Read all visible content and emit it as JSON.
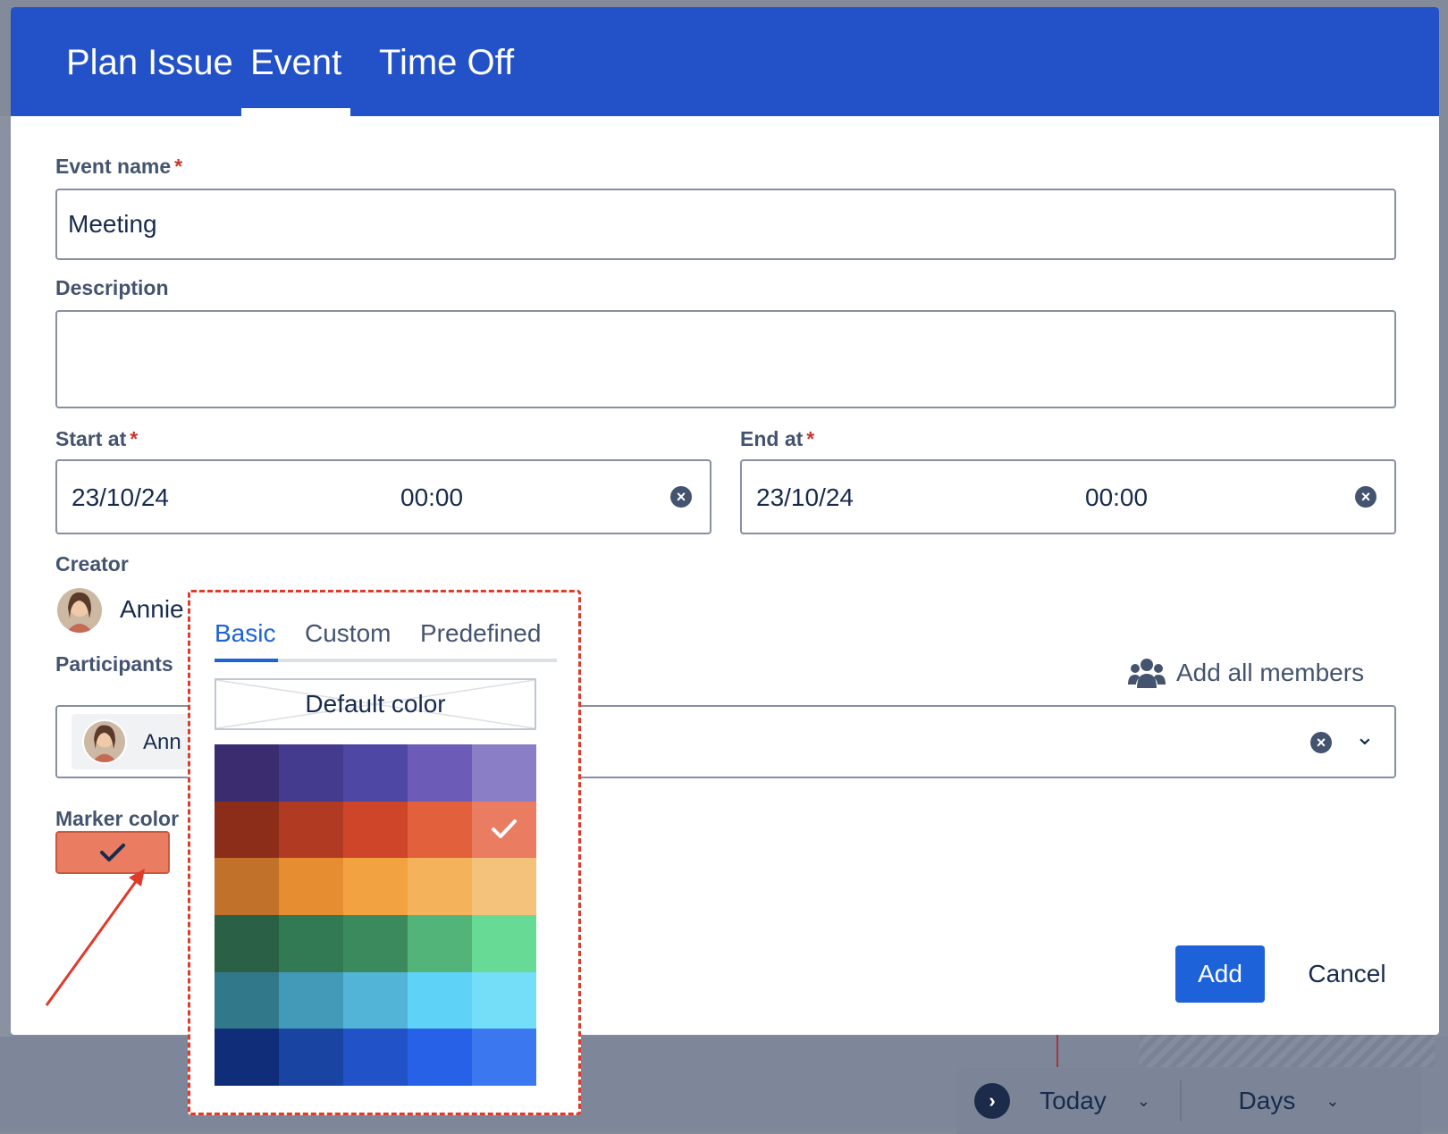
{
  "tabs": [
    {
      "label": "Plan Issue",
      "active": false
    },
    {
      "label": "Event",
      "active": true
    },
    {
      "label": "Time Off",
      "active": false
    }
  ],
  "form": {
    "event_name_label": "Event name",
    "required_mark": "*",
    "event_name_value": "Meeting",
    "description_label": "Description",
    "description_value": "",
    "start_label": "Start at",
    "start_date": "23/10/24",
    "start_time": "00:00",
    "end_label": "End at",
    "end_date": "23/10/24",
    "end_time": "00:00",
    "creator_label": "Creator",
    "creator_name": "Annie",
    "participants_label": "Participants",
    "add_all_label": "Add all members",
    "participant_chip": "Ann",
    "marker_color_label": "Marker color",
    "marker_color_value": "#e97c61"
  },
  "buttons": {
    "add": "Add",
    "cancel": "Cancel"
  },
  "color_picker": {
    "tabs": [
      "Basic",
      "Custom",
      "Predefined"
    ],
    "active_tab": "Basic",
    "default_color_label": "Default color",
    "selected": "#e97c61",
    "swatches": [
      [
        "#3b2c70",
        "#443a8e",
        "#4f47a4",
        "#6c5cb8",
        "#8a7fc6"
      ],
      [
        "#8c2d19",
        "#b03b22",
        "#cf4529",
        "#e3603d",
        "#e97c61"
      ],
      [
        "#c1712a",
        "#e68c31",
        "#f2a240",
        "#f4b25a",
        "#f5c27b"
      ],
      [
        "#2a6045",
        "#327a53",
        "#3b8a5d",
        "#53b47a",
        "#67db95"
      ],
      [
        "#32788b",
        "#4299b8",
        "#52b4d6",
        "#5fd3f7",
        "#74def9"
      ],
      [
        "#0f2d78",
        "#1a44a2",
        "#2152c8",
        "#2761e8",
        "#3b78f0"
      ]
    ]
  },
  "bottom_toolbar": {
    "today": "Today",
    "days": "Days"
  },
  "icons": {
    "clear": "close-circle-icon",
    "dropdown": "chevron-down-icon",
    "group": "people-group-icon",
    "check": "check-icon"
  }
}
